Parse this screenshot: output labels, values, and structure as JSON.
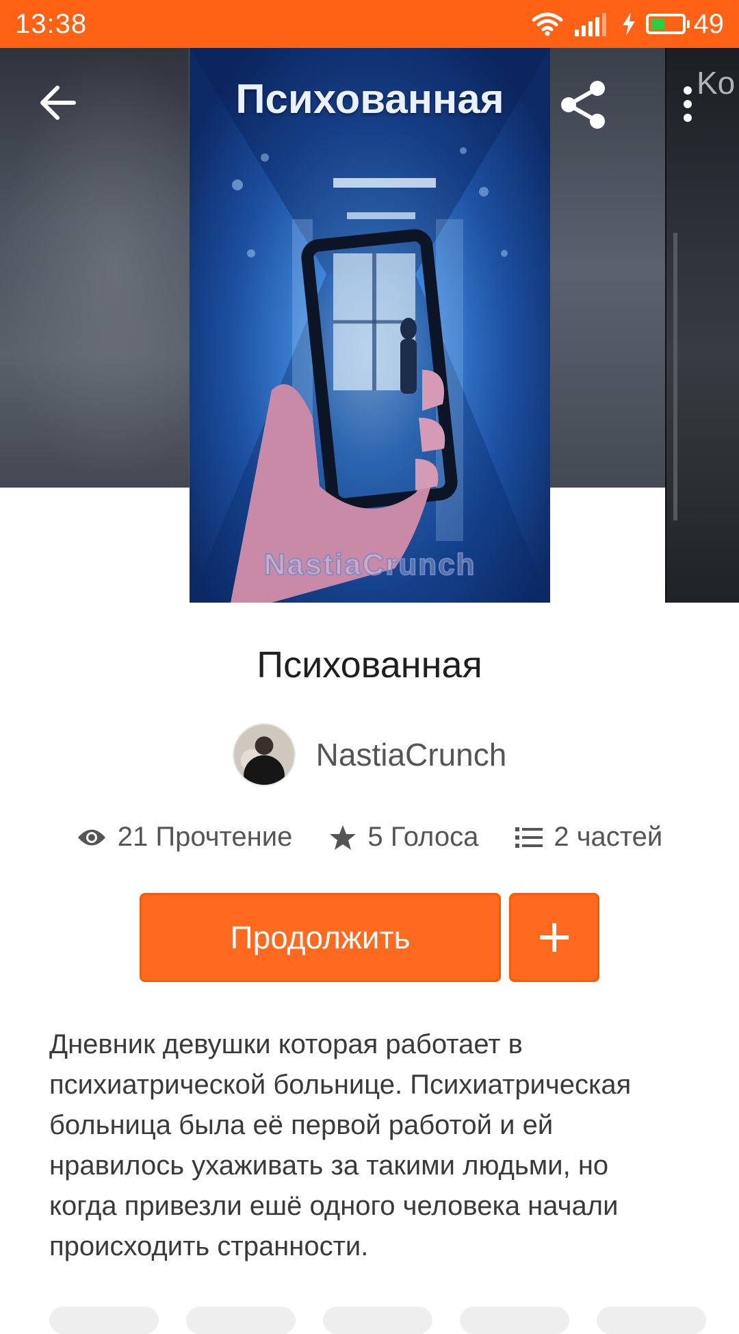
{
  "status_bar": {
    "time": "13:38",
    "battery_percent": "49",
    "battery_level": 0.49,
    "icons": [
      "wifi-icon",
      "signal-icon",
      "charging-icon",
      "battery-icon"
    ]
  },
  "header": {
    "icons": [
      "back-arrow-icon",
      "share-icon",
      "more-vertical-icon"
    ],
    "next_cover_text": "Ko"
  },
  "cover": {
    "title": "Психованная",
    "author": "NastiaCrunch"
  },
  "book": {
    "title": "Психованная",
    "author": "NastiaCrunch"
  },
  "stats": {
    "reads": "21 Прочтение",
    "votes": "5 Голоса",
    "parts": "2 частей"
  },
  "actions": {
    "continue_label": "Продолжить",
    "add_label": "+"
  },
  "description": "Дневник девушки которая работает в\nпсихиатрической больнице. Психиатрическая\nбольница была её первой работой и ей\nнравилось ухаживать за такими людьми, но\nкогда привезли ешё одного человека  начали\nпроисходить странности.",
  "colors": {
    "accent": "#ff6a1e",
    "status_bar": "#ff6214",
    "text_primary": "#1f1f1f",
    "text_secondary": "#555555"
  }
}
